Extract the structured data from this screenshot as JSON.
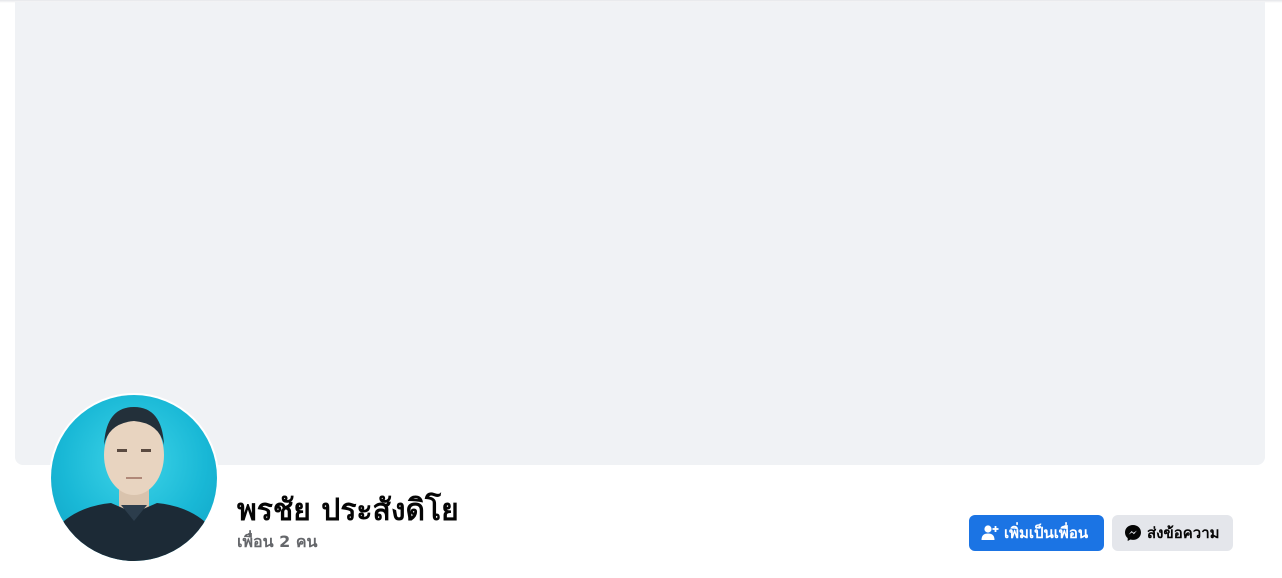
{
  "profile": {
    "name": "พรชัย ประสังดิโย",
    "friends_count": "เพื่อน 2 คน"
  },
  "actions": {
    "add_friend_label": "เพิ่มเป็นเพื่อน",
    "add_friend_icon": "add-friend-icon",
    "message_label": "ส่งข้อความ",
    "message_icon": "messenger-icon"
  },
  "colors": {
    "primary_button": "#1b74e4",
    "secondary_button": "#e4e6eb",
    "cover_background": "#f0f2f5"
  }
}
